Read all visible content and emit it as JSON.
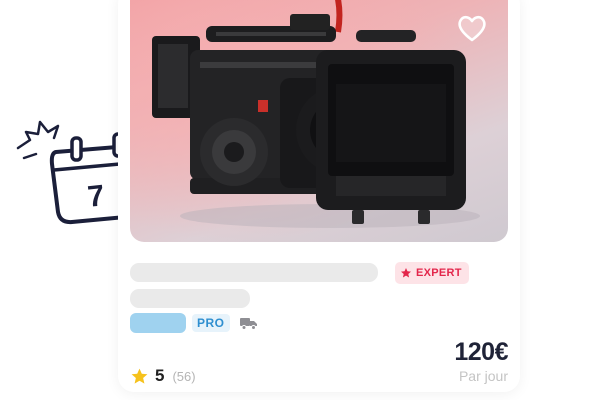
{
  "listing": {
    "badge_label": "EXPERT",
    "pro_label": "PRO",
    "rating_value": "5",
    "review_count": "(56)",
    "price": "120€",
    "price_period": "Par jour"
  },
  "calendar_sticker": {
    "day_number": "7"
  },
  "colors": {
    "expert_badge_bg": "#fde3e7",
    "expert_badge_text": "#e3264b",
    "pro_badge_bg": "#e7f3fb",
    "pro_badge_text": "#2f8fd0",
    "price_text": "#1f2337",
    "star": "#f6c21c"
  },
  "icons": {
    "favorite": "heart-icon",
    "badge": "star-icon",
    "delivery": "truck-icon",
    "rating": "star-icon",
    "sticker": "calendar-icon"
  }
}
